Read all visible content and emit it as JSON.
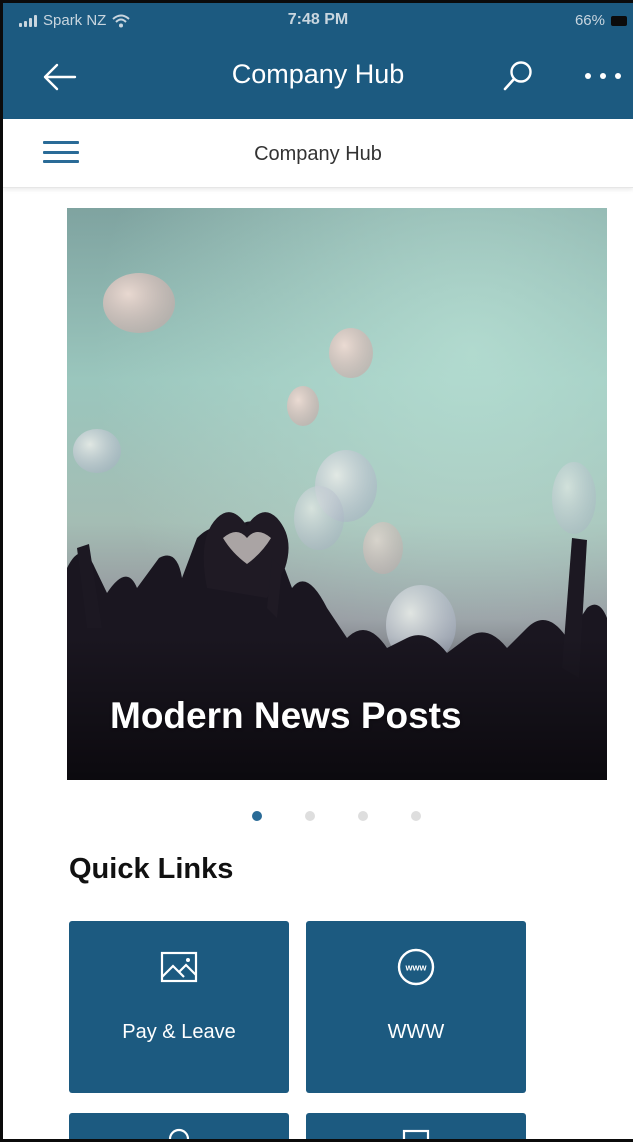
{
  "status_bar": {
    "carrier": "Spark NZ",
    "time": "7:48 PM",
    "battery": "66%"
  },
  "header": {
    "title": "Company Hub",
    "back_icon": "arrow-left-icon",
    "search_icon": "search-icon",
    "more_icon": "more-horizontal-icon"
  },
  "subheader": {
    "title": "Company Hub",
    "menu_icon": "hamburger-icon"
  },
  "hero": {
    "caption": "Modern News Posts",
    "page_count": 4,
    "active_page": 1
  },
  "quick_links": {
    "title": "Quick Links",
    "items": [
      {
        "label": "Pay & Leave",
        "icon": "image-icon"
      },
      {
        "label": "WWW",
        "icon": "www-globe-icon"
      }
    ]
  },
  "colors": {
    "brand": "#1c5a80",
    "accent_dot": "#2a6b97",
    "inactive_dot": "#dedede",
    "background": "#ffffff"
  }
}
